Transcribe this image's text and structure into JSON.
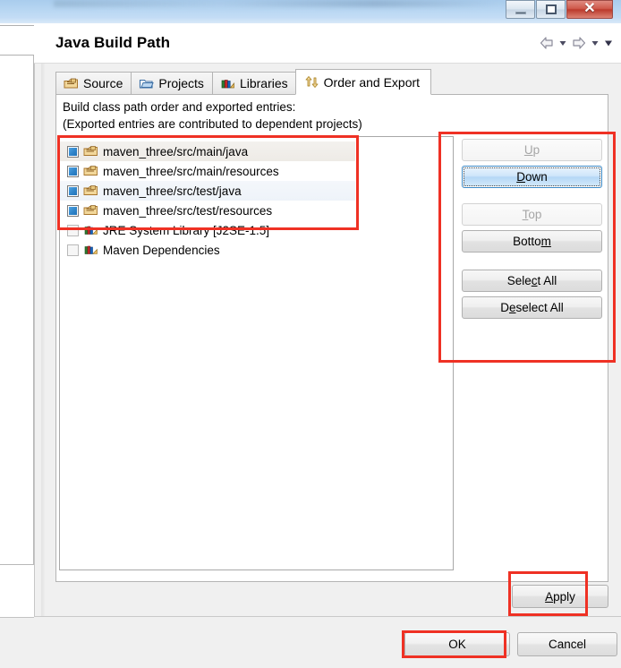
{
  "window_controls": {
    "minimize": "minimize-button",
    "maximize": "maximize-button",
    "close_glyph": "✕"
  },
  "dialog": {
    "title": "Java Build Path",
    "nav": {
      "back": "back-arrow",
      "back_menu": "back-dropdown",
      "forward": "forward-arrow",
      "forward_menu": "forward-dropdown",
      "more_menu": "view-menu-dropdown"
    }
  },
  "tabs": [
    {
      "label": "Source",
      "icon": "source-folder-icon",
      "active": false
    },
    {
      "label": "Projects",
      "icon": "projects-folder-icon",
      "active": false
    },
    {
      "label": "Libraries",
      "icon": "libraries-books-icon",
      "active": false
    },
    {
      "label": "Order and Export",
      "icon": "order-export-icon",
      "active": true
    }
  ],
  "description": {
    "line1": "Build class path order and exported entries:",
    "line2": "(Exported entries are contributed to dependent projects)"
  },
  "entries": [
    {
      "label": "maven_three/src/main/java",
      "checked": true,
      "icon": "source-folder-icon",
      "highlight": "alt"
    },
    {
      "label": "maven_three/src/main/resources",
      "checked": true,
      "icon": "source-folder-icon",
      "highlight": "none"
    },
    {
      "label": "maven_three/src/test/java",
      "checked": true,
      "icon": "source-folder-icon",
      "highlight": "selected"
    },
    {
      "label": "maven_three/src/test/resources",
      "checked": true,
      "icon": "source-folder-icon",
      "highlight": "none"
    },
    {
      "label": "JRE System Library [J2SE-1.5]",
      "checked": false,
      "icon": "library-books-icon",
      "highlight": "none"
    },
    {
      "label": "Maven Dependencies",
      "checked": false,
      "icon": "library-books-icon",
      "highlight": "none"
    }
  ],
  "side_buttons": [
    {
      "label": "Up",
      "mnemonic": "U",
      "state": "disabled"
    },
    {
      "label": "Down",
      "mnemonic": "D",
      "state": "focused"
    },
    {
      "label": "Top",
      "mnemonic": "T",
      "state": "disabled"
    },
    {
      "label": "Bottom",
      "mnemonic": "m",
      "state": "normal"
    },
    {
      "label": "Select All",
      "mnemonic": "c",
      "state": "normal"
    },
    {
      "label": "Deselect All",
      "mnemonic": "e",
      "state": "normal"
    }
  ],
  "footer": {
    "apply": "Apply",
    "ok": "OK",
    "cancel": "Cancel"
  },
  "annotations": {
    "color": "#ef3124",
    "regions": [
      "entries-list",
      "side-buttons-panel",
      "apply-button",
      "ok-button"
    ]
  }
}
